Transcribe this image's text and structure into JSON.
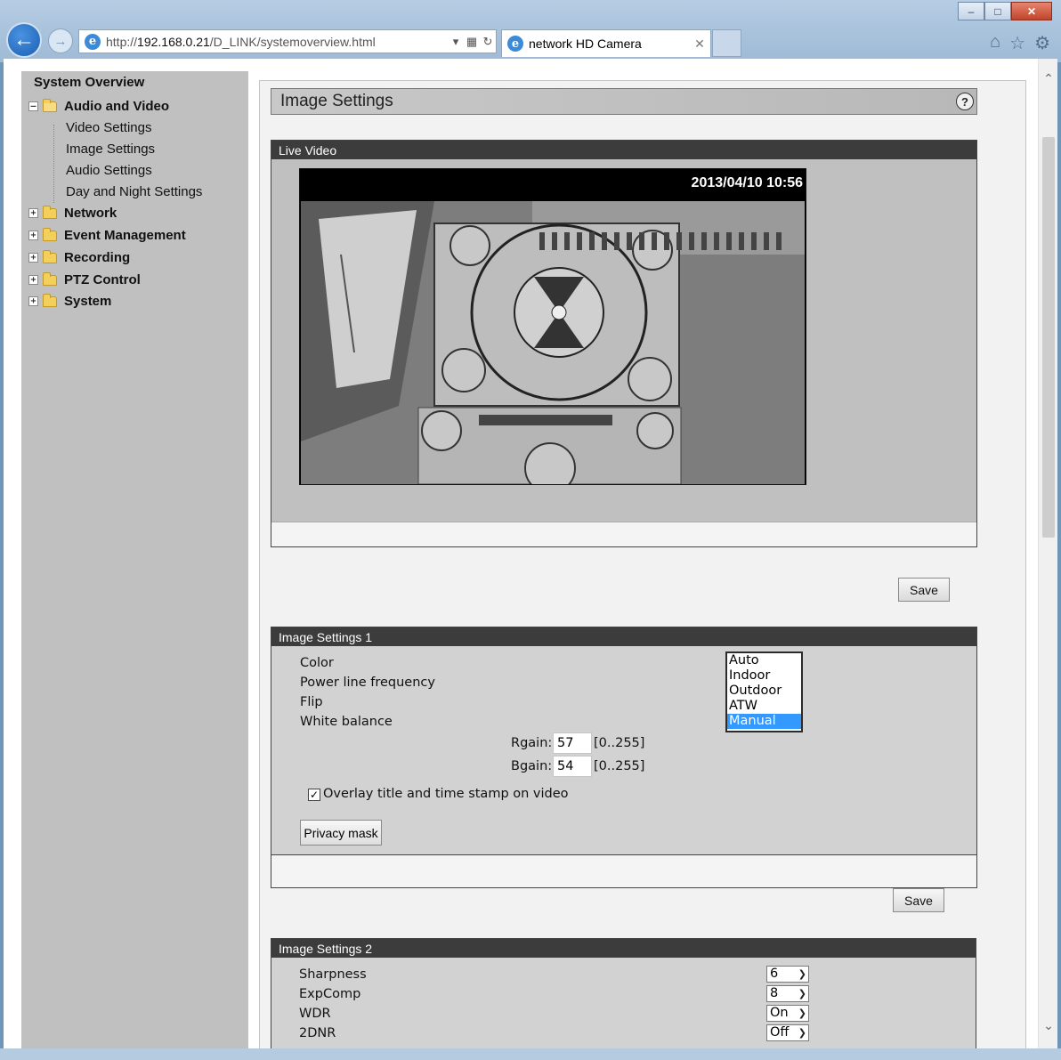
{
  "browser": {
    "url_prefix": "http://",
    "url_host": "192.168.0.21",
    "url_path": "/D_LINK/systemoverview.html",
    "tab_title": "network HD Camera"
  },
  "nav": {
    "title": "System Overview",
    "items": [
      {
        "label": "Audio and Video"
      },
      {
        "label": "Video Settings"
      },
      {
        "label": "Image Settings"
      },
      {
        "label": "Audio Settings"
      },
      {
        "label": "Day and Night Settings"
      },
      {
        "label": "Network"
      },
      {
        "label": "Event Management"
      },
      {
        "label": "Recording"
      },
      {
        "label": "PTZ Control"
      },
      {
        "label": "System"
      }
    ]
  },
  "page": {
    "title": "Image Settings",
    "help": "?"
  },
  "live": {
    "header": "Live Video",
    "timestamp": "2013/04/10 10:56",
    "save_label": "Save"
  },
  "settings1": {
    "header": "Image Settings 1",
    "labels": [
      "Color",
      "Power line frequency",
      "Flip",
      "White balance"
    ],
    "white_balance_options": [
      "Auto",
      "Indoor",
      "Outdoor",
      "ATW",
      "Manual"
    ],
    "white_balance_selected": "Manual",
    "rgain_label": "Rgain:",
    "rgain_value": "57",
    "rgain_range": "[0..255]",
    "bgain_label": "Bgain:",
    "bgain_value": "54",
    "bgain_range": "[0..255]",
    "overlay_label": "Overlay title and time stamp on video",
    "overlay_checked": true,
    "privacy_label": "Privacy mask",
    "save_label": "Save"
  },
  "settings2": {
    "header": "Image Settings 2",
    "rows": [
      {
        "label": "Sharpness",
        "value": "6"
      },
      {
        "label": "ExpComp",
        "value": "8"
      },
      {
        "label": "WDR",
        "value": "On"
      },
      {
        "label": "2DNR",
        "value": "Off"
      }
    ]
  }
}
